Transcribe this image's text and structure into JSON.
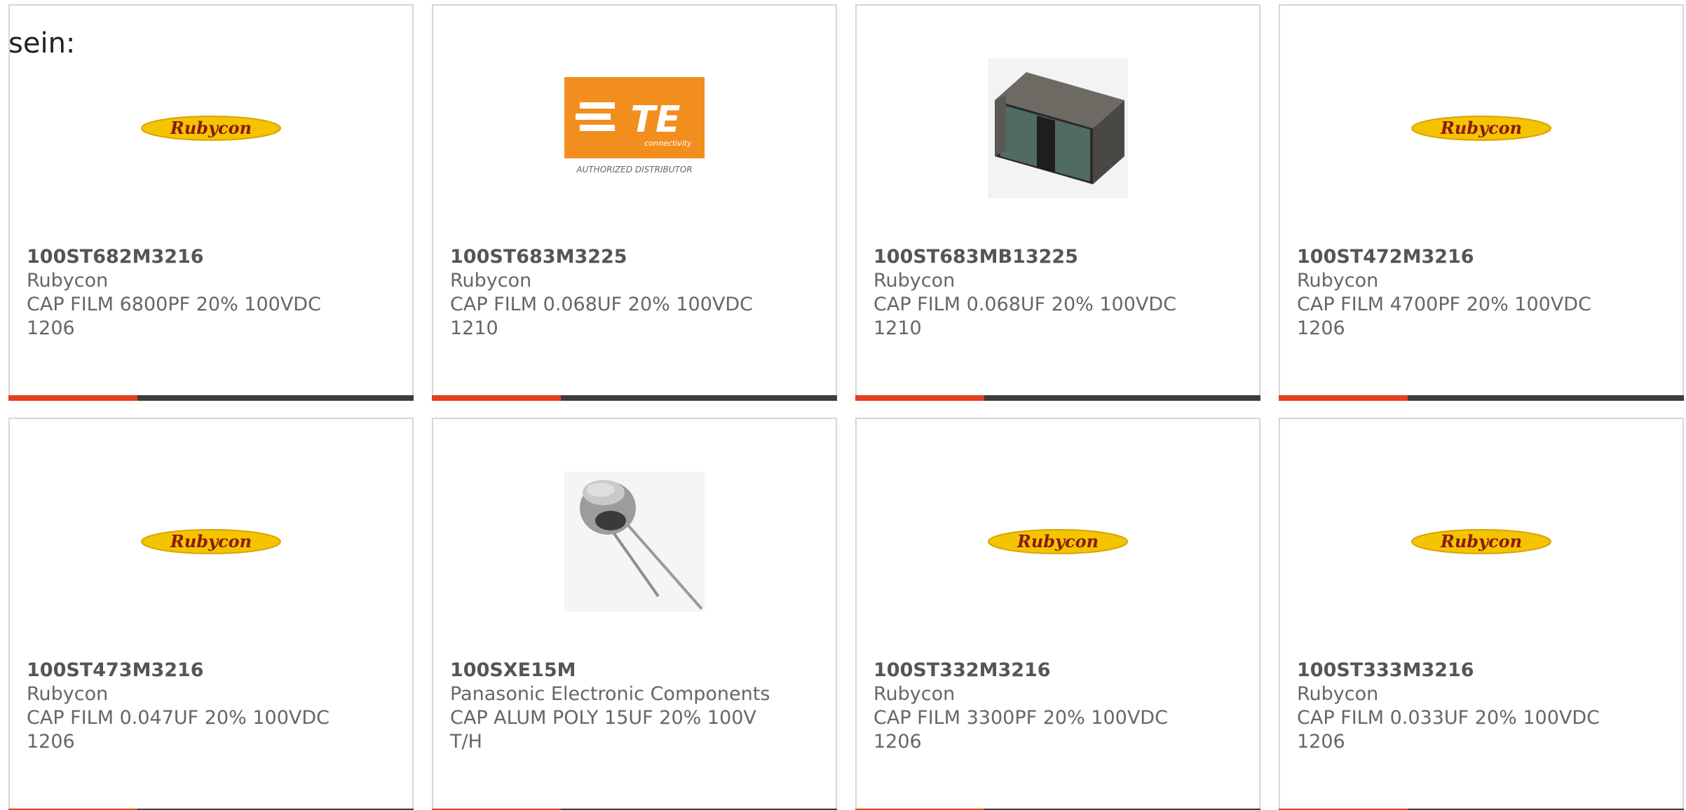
{
  "intro_text": "sein:",
  "colors": {
    "bar_accent": "#e5401c",
    "bar_rest": "#3d3d3d",
    "rubycon_yellow": "#f5c400",
    "rubycon_text": "#8a1a12",
    "te_orange": "#f28e1e"
  },
  "products": [
    {
      "part_number": "100ST682M3216",
      "manufacturer": "Rubycon",
      "description": "CAP FILM 6800PF 20% 100VDC",
      "package": "1206",
      "image": "rubycon-logo",
      "logo_text": "Rubycon"
    },
    {
      "part_number": "100ST683M3225",
      "manufacturer": "Rubycon",
      "description": "CAP FILM 0.068UF 20% 100VDC",
      "package": "1210",
      "image": "te-authorized-distributor-logo",
      "logo_text": "TE",
      "logo_subtext": "connectivity",
      "logo_caption": "AUTHORIZED DISTRIBUTOR"
    },
    {
      "part_number": "100ST683MB13225",
      "manufacturer": "Rubycon",
      "description": "CAP FILM 0.068UF 20% 100VDC",
      "package": "1210",
      "image": "film-capacitor-photo"
    },
    {
      "part_number": "100ST472M3216",
      "manufacturer": "Rubycon",
      "description": "CAP FILM 4700PF 20% 100VDC",
      "package": "1206",
      "image": "rubycon-logo",
      "logo_text": "Rubycon"
    },
    {
      "part_number": "100ST473M3216",
      "manufacturer": "Rubycon",
      "description": "CAP FILM 0.047UF 20% 100VDC",
      "package": "1206",
      "image": "rubycon-logo",
      "logo_text": "Rubycon"
    },
    {
      "part_number": "100SXE15M",
      "manufacturer": "Panasonic Electronic Components",
      "description": "CAP ALUM POLY 15UF 20% 100V",
      "package": "T/H",
      "image": "radial-capacitor-photo"
    },
    {
      "part_number": "100ST332M3216",
      "manufacturer": "Rubycon",
      "description": "CAP FILM 3300PF 20% 100VDC",
      "package": "1206",
      "image": "rubycon-logo",
      "logo_text": "Rubycon"
    },
    {
      "part_number": "100ST333M3216",
      "manufacturer": "Rubycon",
      "description": "CAP FILM 0.033UF 20% 100VDC",
      "package": "1206",
      "image": "rubycon-logo",
      "logo_text": "Rubycon"
    }
  ]
}
